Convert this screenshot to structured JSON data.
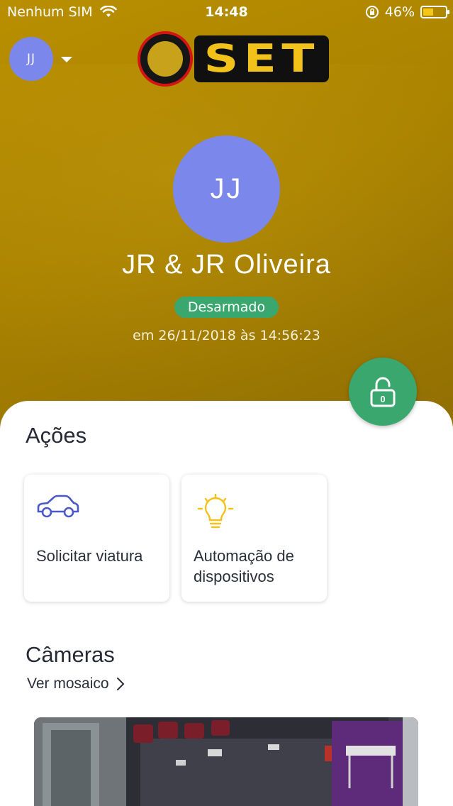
{
  "status_bar": {
    "carrier": "Nenhum SIM",
    "time": "14:48",
    "battery": "46%",
    "battery_level": 0.46
  },
  "account": {
    "initials": "JJ",
    "name": "JR & JR Oliveira",
    "status": "Desarmado",
    "timestamp": "em 26/11/2018 às 14:56:23"
  },
  "logo": {
    "text": "SET"
  },
  "actions": {
    "title": "Ações",
    "items": [
      {
        "label": "Solicitar viatura",
        "icon": "car-icon"
      },
      {
        "label": "Automação de dispositivos",
        "icon": "lightbulb-icon"
      }
    ]
  },
  "cameras": {
    "title": "Câmeras",
    "mosaic_link": "Ver mosaico"
  },
  "colors": {
    "header": "#a98200",
    "avatar": "#7b87ea",
    "status_green": "#3aa86e",
    "icon_blue": "#4a59c7",
    "icon_yellow": "#f2c21a"
  }
}
